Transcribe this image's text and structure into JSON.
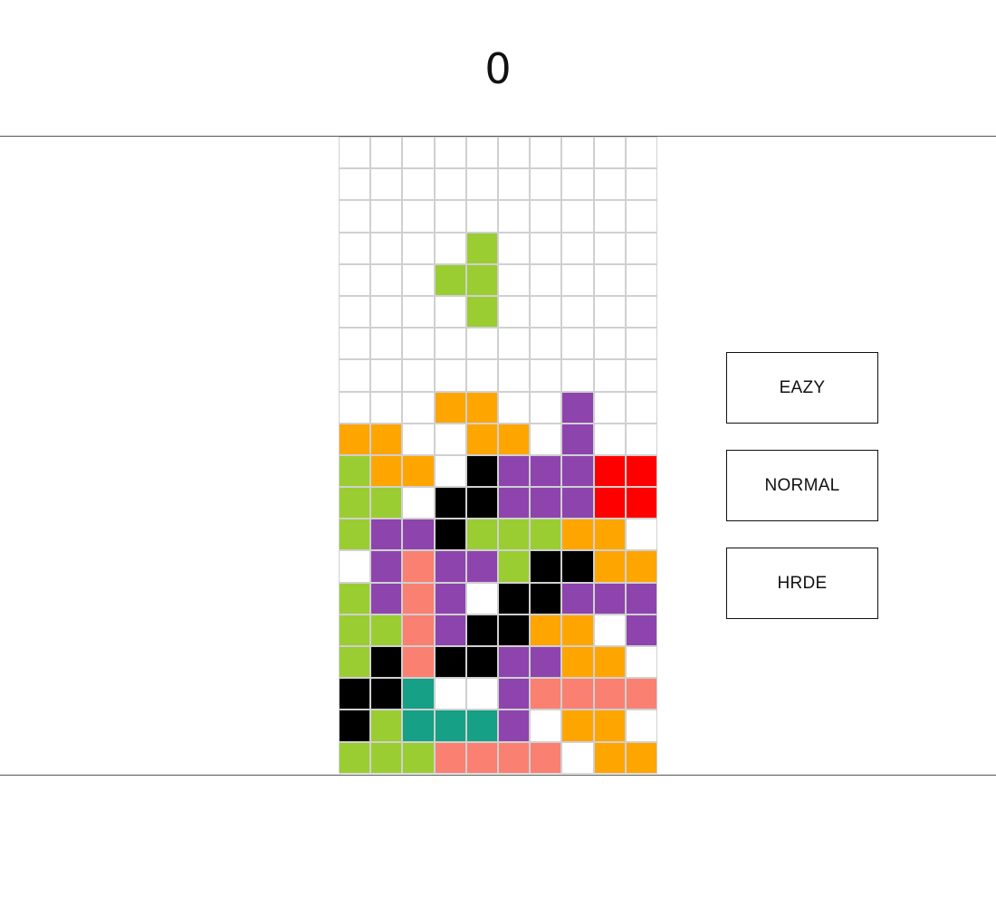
{
  "score": "0",
  "difficulty_buttons": [
    {
      "label": "EAZY"
    },
    {
      "label": "NORMAL"
    },
    {
      "label": "HRDE"
    }
  ],
  "board": {
    "columns": 10,
    "rows": 20,
    "colors": {
      ".": "#ffffff",
      "G": "#9acd32",
      "O": "#ffa500",
      "P": "#8e44ad",
      "K": "#000000",
      "R": "#ff0000",
      "S": "#fa8072",
      "T": "#16a085"
    },
    "grid": [
      "..........",
      "..........",
      "..........",
      "....G.....",
      "...GG.....",
      "....G.....",
      "..........",
      "..........",
      "...OO..P..",
      "OO..OO.P..",
      "GOO.KPPPRR",
      "GG.KKPPPRR",
      "GPPKGGGOO.",
      ".PSPPGKKOO",
      "GPSP.KKPPP",
      "GGSPKKOO.P",
      "GKSKKPPOO.",
      "KKT..PSSSS",
      "KGTTTP.OO.",
      "GGGSSSS.OO"
    ]
  }
}
